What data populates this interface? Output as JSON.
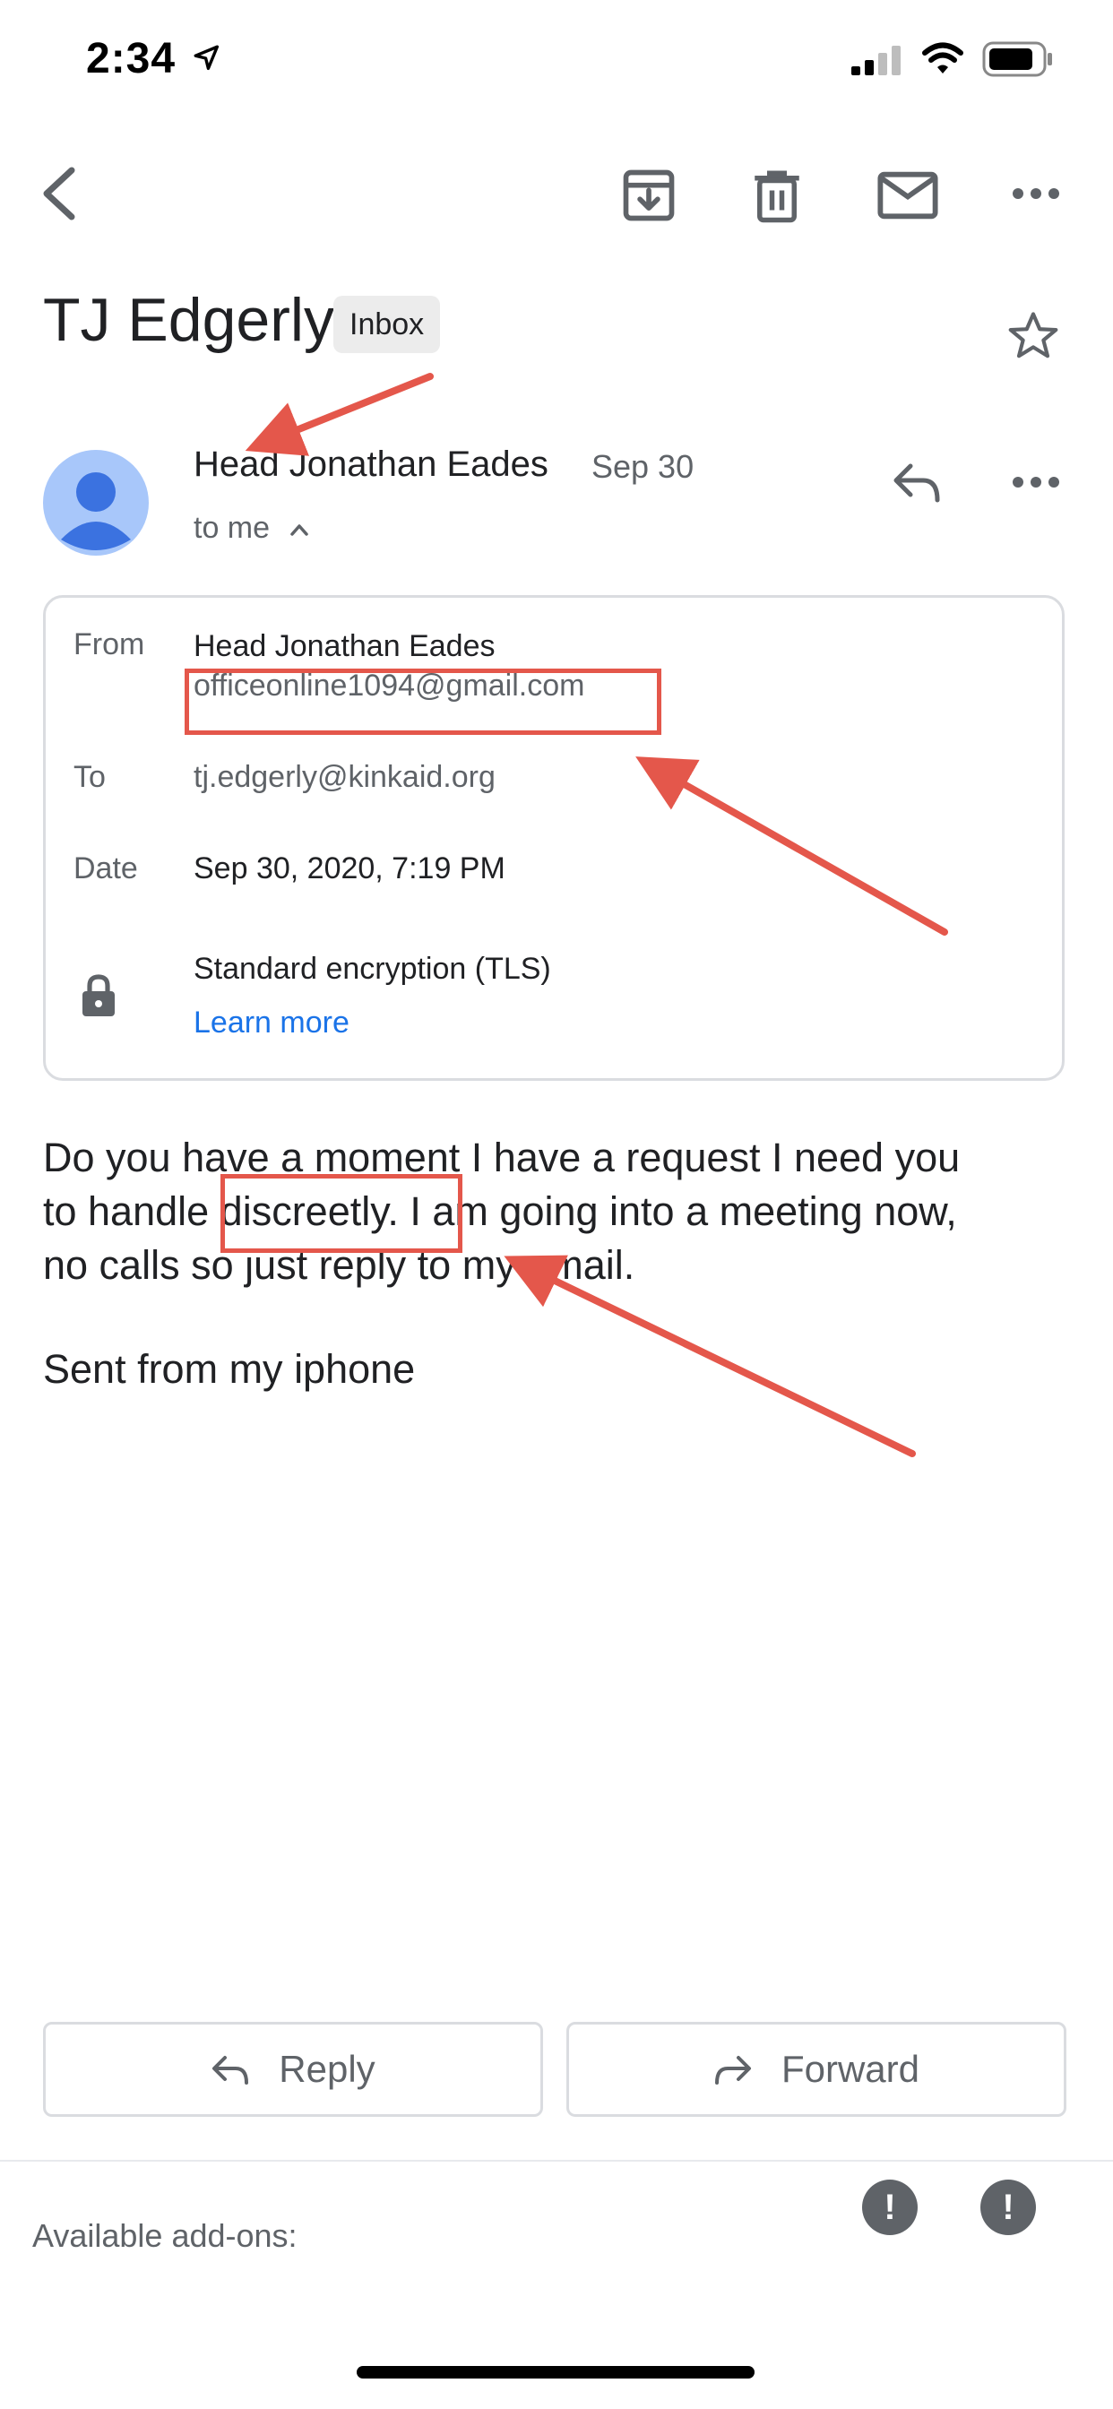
{
  "status_bar": {
    "time": "2:34"
  },
  "toolbar": {
    "icons": [
      "back-icon",
      "archive-icon",
      "trash-icon",
      "mail-icon",
      "more-icon"
    ]
  },
  "email": {
    "subject": "TJ Edgerly",
    "label": "Inbox",
    "sender_name": "Head Jonathan Eades",
    "date_short": "Sep 30",
    "to_me": "to me",
    "details": {
      "from_label": "From",
      "from_name": "Head Jonathan Eades",
      "from_email": "officeonline1094@gmail.com",
      "to_label": "To",
      "to_email": "tj.edgerly@kinkaid.org",
      "date_label": "Date",
      "date_value": "Sep 30, 2020, 7:19 PM",
      "encryption": "Standard encryption (TLS)",
      "learn_more": "Learn more"
    },
    "body_lines": [
      "Do you have a moment I have a request I need you",
      "to handle discreetly. I am going into a meeting now,",
      "no calls so just reply to my email."
    ],
    "signature": "Sent from my iphone"
  },
  "actions": {
    "reply": "Reply",
    "forward": "Forward"
  },
  "addons": {
    "label": "Available add-ons:",
    "badge": "!"
  },
  "colors": {
    "annotation": "#e4574b",
    "link": "#1a73e8",
    "avatar_bg": "#a8c7fa",
    "avatar_fg": "#3b72e0"
  }
}
